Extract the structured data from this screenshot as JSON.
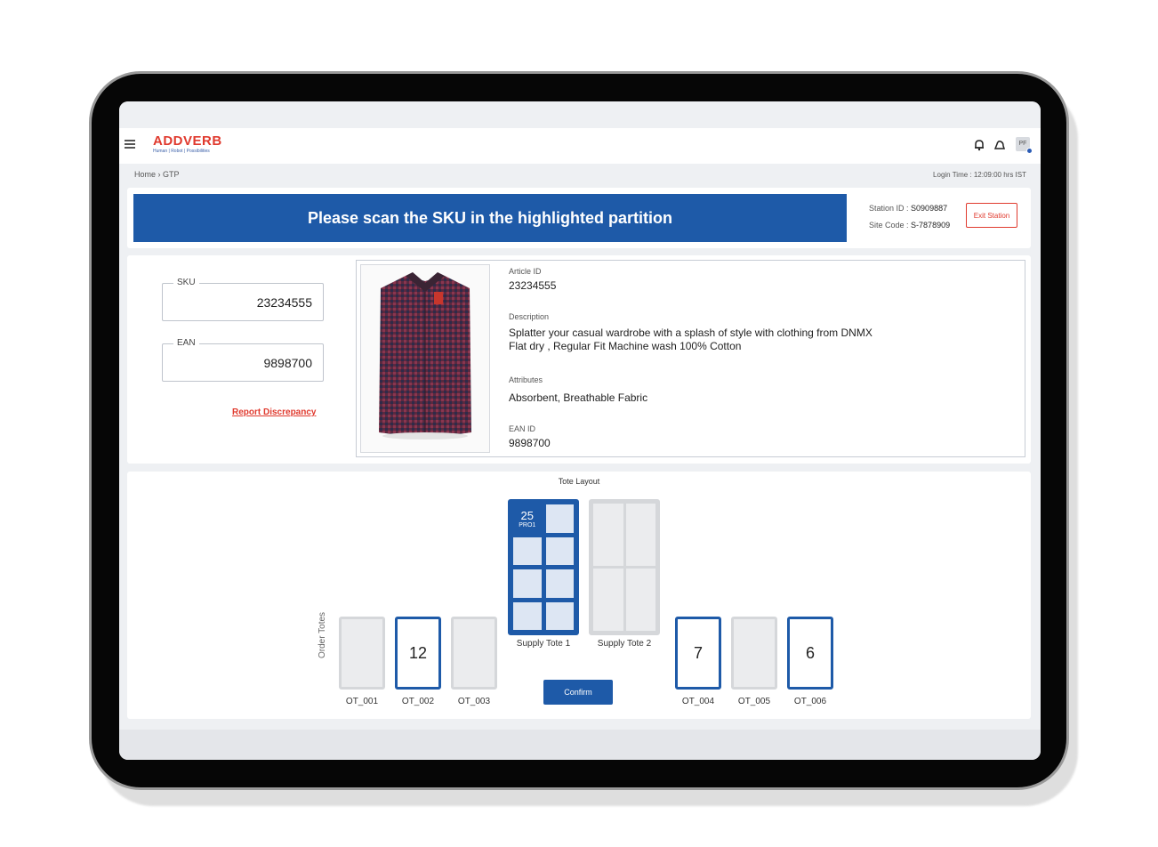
{
  "header": {
    "logo": "ADDVERB",
    "tagline": "Human | Robot | Possibilities",
    "avatar_initials": "PF",
    "icons": [
      "menu-icon",
      "bell-icon",
      "notification-icon"
    ]
  },
  "breadcrumb": "Home › GTP",
  "login_time": "Login Time : 12:09:00 hrs IST",
  "instruction": "Please scan the SKU in the highlighted partition",
  "station": {
    "id_label": "Station ID :",
    "id_value": "S0909887",
    "site_label": "Site Code :",
    "site_value": "S-7878909",
    "exit_label": "Exit Station"
  },
  "scan": {
    "sku_label": "SKU",
    "sku_value": "23234555",
    "ean_label": "EAN",
    "ean_value": "9898700",
    "report_label": "Report Discrepancy"
  },
  "article": {
    "article_id_label": "Article ID",
    "article_id": "23234555",
    "description_label": "Description",
    "description_line1": "Splatter your casual wardrobe with a splash of style with clothing from DNMX",
    "description_line2": "Flat dry , Regular Fit Machine wash   100% Cotton",
    "attributes_label": "Attributes",
    "attributes": "Absorbent, Breathable Fabric",
    "ean_id_label": "EAN ID",
    "ean_id": "9898700"
  },
  "tote_layout": {
    "title": "Tote Layout",
    "active_cell_count": "25",
    "active_cell_code": "PRO1",
    "supply_tote_1": "Supply Tote 1",
    "supply_tote_2": "Supply Tote 2",
    "order_totes_label": "Order Totes",
    "order_totes": [
      {
        "label": "OT_001",
        "count": ""
      },
      {
        "label": "OT_002",
        "count": "12"
      },
      {
        "label": "OT_003",
        "count": ""
      },
      {
        "label": "OT_004",
        "count": "7"
      },
      {
        "label": "OT_005",
        "count": ""
      },
      {
        "label": "OT_006",
        "count": "6"
      }
    ],
    "confirm_label": "Confirm"
  },
  "colors": {
    "brand_red": "#e03a2e",
    "primary_blue": "#1e5aa8"
  }
}
